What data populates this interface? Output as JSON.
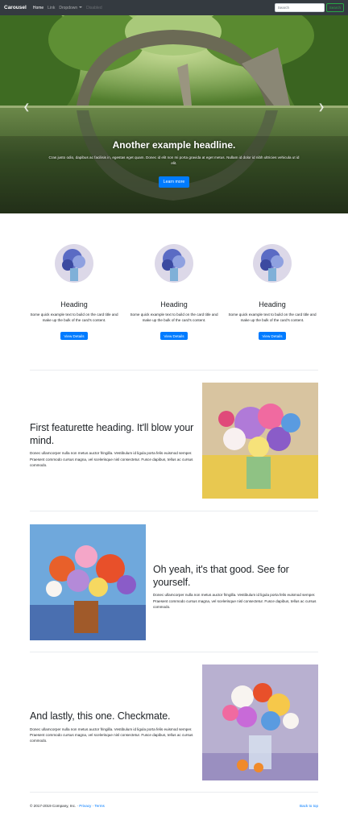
{
  "navbar": {
    "brand": "Carousel",
    "links": [
      "Home",
      "Link",
      "Dropdown",
      "Disabled"
    ],
    "search_placeholder": "Search",
    "search_button": "Search"
  },
  "carousel": {
    "headline": "Another example headline.",
    "text": "Cras justo odio, dapibus ac facilisis in, egestas eget quam. Donec id elit non mi porta gravida at eget metus. Nullam id dolor id nibh ultricies vehicula ut id elit.",
    "button": "Learn more"
  },
  "marketing": [
    {
      "heading": "Heading",
      "text": "Some quick example text to build on the card title and make up the bulk of the card's content.",
      "button": "View Details"
    },
    {
      "heading": "Heading",
      "text": "Some quick example text to build on the card title and make up the bulk of the card's content.",
      "button": "View Details"
    },
    {
      "heading": "Heading",
      "text": "Some quick example text to build on the card title and make up the bulk of the card's content.",
      "button": "View Details"
    }
  ],
  "featurettes": [
    {
      "heading": "First featurette heading. It'll blow your mind.",
      "text": "Donec ullamcorper nulla non metus auctor fringilla. Vestibulum id ligula porta felis euismod semper. Praesent commodo cursus magna, vel scelerisque nisl consectetur. Fusce dapibus, tellus ac cursus commodo."
    },
    {
      "heading": "Oh yeah, it's that good. See for yourself.",
      "text": "Donec ullamcorper nulla non metus auctor fringilla. Vestibulum id ligula porta felis euismod semper. Praesent commodo cursus magna, vel scelerisque nisl consectetur. Fusce dapibus, tellus ac cursus commodo."
    },
    {
      "heading": "And lastly, this one. Checkmate.",
      "text": "Donec ullamcorper nulla non metus auctor fringilla. Vestibulum id ligula porta felis euismod semper. Praesent commodo cursus magna, vel scelerisque nisl consectetur. Fusce dapibus, tellus ac cursus commodo."
    }
  ],
  "footer": {
    "copyright": "© 2017-2019 Company, Inc.",
    "privacy": "Privacy",
    "terms": "Terms",
    "back_to_top": "Back to top"
  },
  "colors": {
    "navbar_bg": "#343a40",
    "primary": "#007bff",
    "success": "#28a745"
  }
}
